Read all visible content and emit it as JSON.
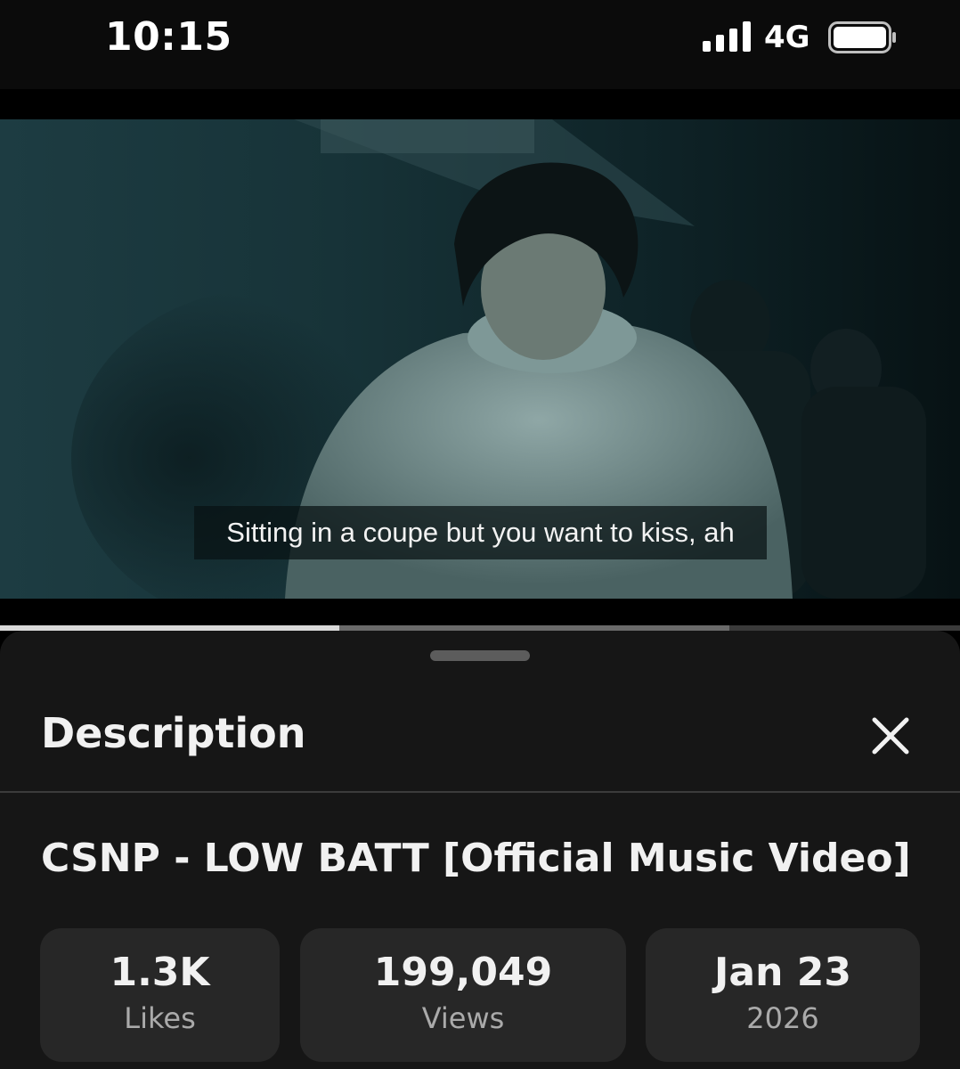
{
  "status_bar": {
    "time": "10:15",
    "network": "4G",
    "icons": [
      "signal-icon",
      "battery-icon"
    ]
  },
  "video": {
    "subtitle": "Sitting in a coupe but you want to kiss, ah",
    "progress_played_fraction": 0.353,
    "progress_buffered_fraction": 0.76
  },
  "description_sheet": {
    "title": "Description",
    "close_icon": "close-icon",
    "video_title": "CSNP - LOW BATT [Official Music Video]",
    "stats": {
      "likes": {
        "value": "1.3K",
        "label": "Likes"
      },
      "views": {
        "value": "199,049",
        "label": "Views"
      },
      "date": {
        "value": "Jan 23",
        "label": "2026"
      }
    }
  },
  "colors": {
    "sheet_background": "#161616",
    "card_background": "#272727",
    "progress_played": "#d9d9d9",
    "text_primary": "#f1f1f1",
    "text_secondary": "#aaaaaa"
  }
}
